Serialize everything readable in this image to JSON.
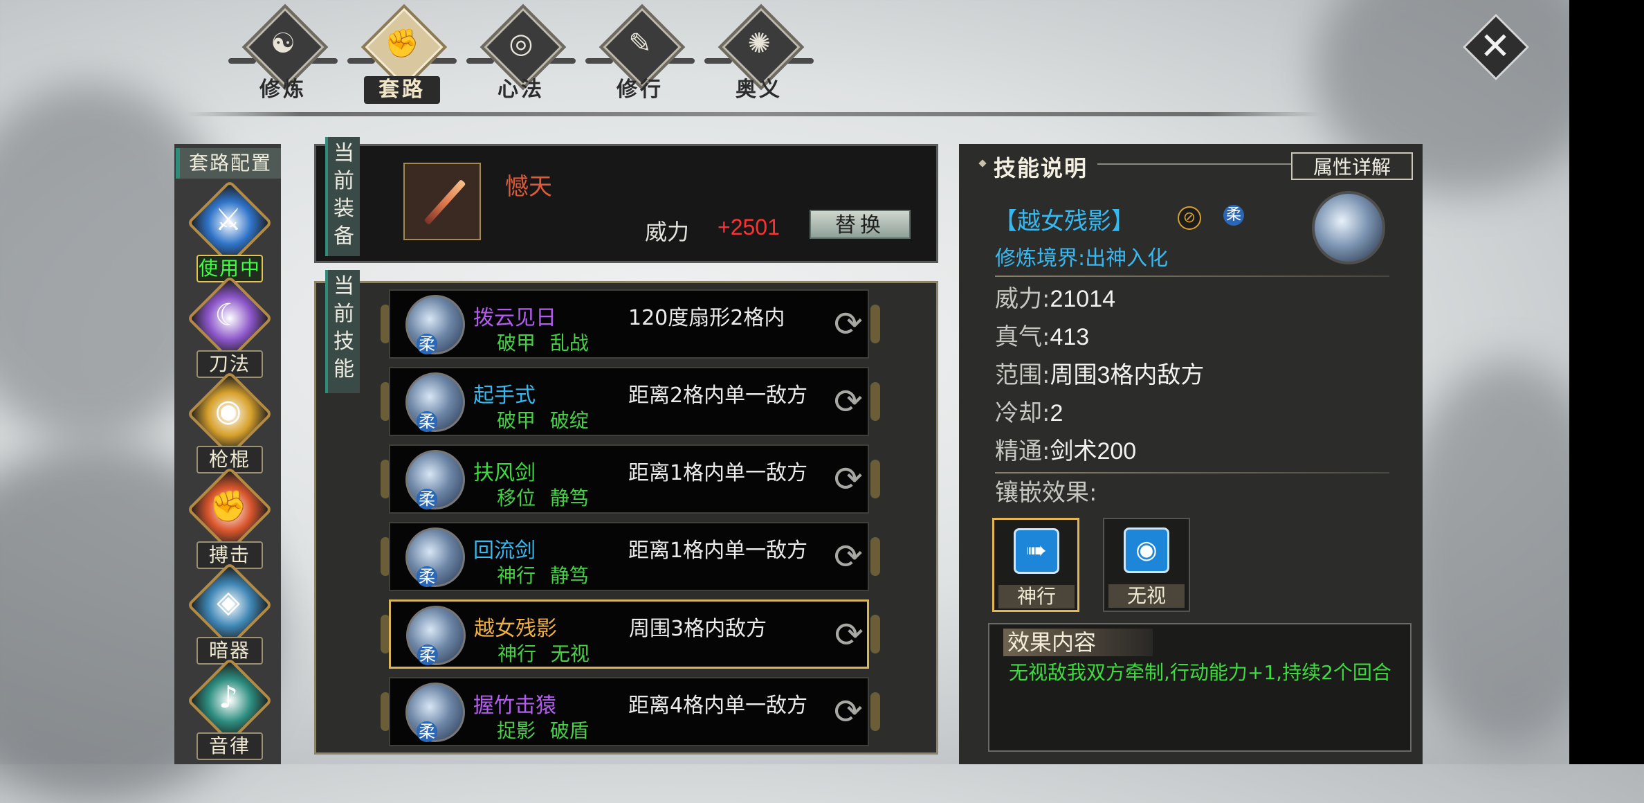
{
  "nav": {
    "tabs": [
      {
        "label": "修炼",
        "glyph": "☯",
        "active": false
      },
      {
        "label": "套路",
        "glyph": "✊",
        "active": true
      },
      {
        "label": "心法",
        "glyph": "◎",
        "active": false
      },
      {
        "label": "修行",
        "glyph": "✎",
        "active": false
      },
      {
        "label": "奥义",
        "glyph": "✺",
        "active": false
      }
    ],
    "close_icon": "close-icon"
  },
  "left": {
    "title": "套路配置",
    "categories": [
      {
        "label": "使用中",
        "glyph": "⚔",
        "color": "#2f74c9",
        "active": true
      },
      {
        "label": "刀法",
        "glyph": "☾",
        "color": "#8c56c9",
        "active": false
      },
      {
        "label": "枪棍",
        "glyph": "◉",
        "color": "#d7a12c",
        "active": false
      },
      {
        "label": "搏击",
        "glyph": "✊",
        "color": "#d9562c",
        "active": false
      },
      {
        "label": "暗器",
        "glyph": "◈",
        "color": "#3e86b5",
        "active": false
      },
      {
        "label": "音律",
        "glyph": "♪",
        "color": "#2d8e80",
        "active": false
      }
    ]
  },
  "equipment": {
    "tab_label": "当前装备",
    "weapon_name": "憾天",
    "power_label": "威力",
    "power_value": "+2501",
    "replace_label": "替换"
  },
  "skills": {
    "tab_label": "当前技能",
    "badge": "柔",
    "list": [
      {
        "name": "拨云见日",
        "name_color": "#b35cf0",
        "tags": "破甲 乱战",
        "range": "120度扇形2格内",
        "selected": false
      },
      {
        "name": "起手式",
        "name_color": "#36b9f0",
        "tags": "破甲 破绽",
        "range": "距离2格内单一敌方",
        "selected": false
      },
      {
        "name": "扶风剑",
        "name_color": "#3ddc3d",
        "tags": "移位 静笃",
        "range": "距离1格内单一敌方",
        "selected": false
      },
      {
        "name": "回流剑",
        "name_color": "#36b9f0",
        "tags": "神行 静笃",
        "range": "距离1格内单一敌方",
        "selected": false
      },
      {
        "name": "越女残影",
        "name_color": "#f0b040",
        "tags": "神行 无视",
        "range": "周围3格内敌方",
        "selected": true
      },
      {
        "name": "握竹击猿",
        "name_color": "#b35cf0",
        "tags": "捉影 破盾",
        "range": "距离4格内单一敌方",
        "selected": false
      }
    ]
  },
  "detail": {
    "title": "技能说明",
    "attr_button": "属性详解",
    "skill_name": "【越女残影】",
    "badge": "柔",
    "realm": "修炼境界:出神入化",
    "stats": [
      {
        "label": "威力:",
        "value": "21014"
      },
      {
        "label": "真气:",
        "value": "413"
      },
      {
        "label": "范围:",
        "value": "周围3格内敌方"
      },
      {
        "label": "冷却:",
        "value": "2"
      },
      {
        "label": "精通:",
        "value": "剑术200"
      }
    ],
    "inlay_label": "镶嵌效果:",
    "gems": [
      {
        "label": "神行",
        "glyph": "➠",
        "active": true
      },
      {
        "label": "无视",
        "glyph": "◉",
        "active": false
      }
    ],
    "effect_title": "效果内容",
    "effect_text": "无视敌我双方牵制,行动能力+1,持续2个回合"
  }
}
